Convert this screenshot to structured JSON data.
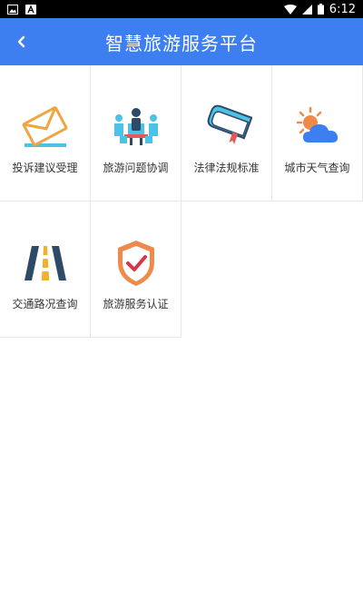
{
  "status_bar": {
    "time": "6:12"
  },
  "header": {
    "title": "智慧旅游服务平台",
    "back_icon": "chevron-left-icon"
  },
  "grid": {
    "items": [
      {
        "label": "投诉建议受理",
        "icon": "envelope-icon"
      },
      {
        "label": "旅游问题协调",
        "icon": "meeting-icon"
      },
      {
        "label": "法律法规标准",
        "icon": "book-icon"
      },
      {
        "label": "城市天气查询",
        "icon": "weather-icon"
      },
      {
        "label": "交通路况查询",
        "icon": "road-icon"
      },
      {
        "label": "旅游服务认证",
        "icon": "shield-check-icon"
      }
    ]
  },
  "colors": {
    "primary": "#3d7ff0",
    "accent_orange": "#f08a4b",
    "accent_cyan": "#4cc3e6",
    "dark_blue": "#2f4a66"
  }
}
